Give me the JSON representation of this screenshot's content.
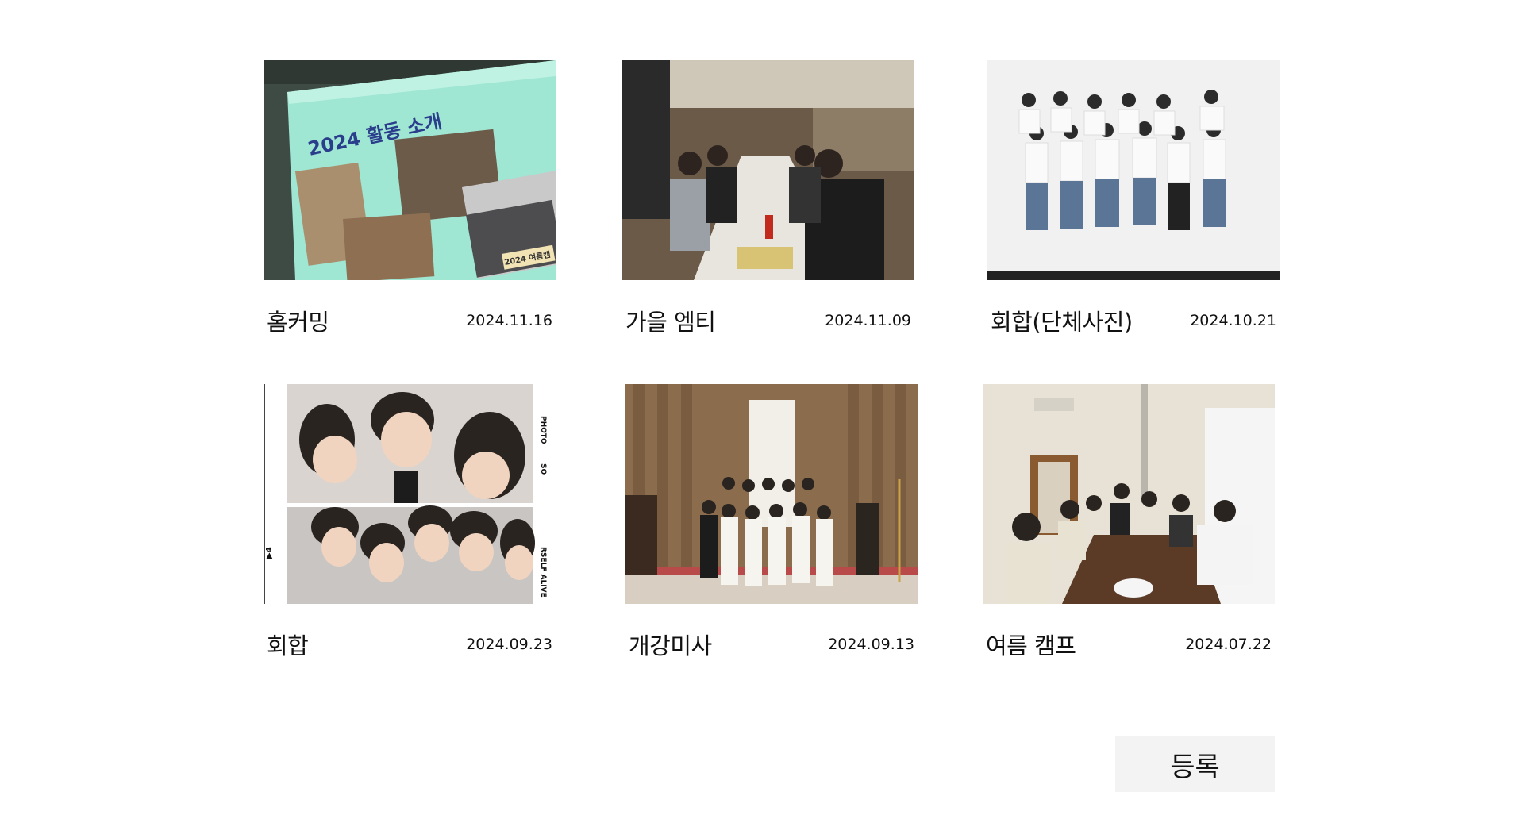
{
  "gallery": {
    "items": [
      {
        "title": "홈커밍",
        "date": "2024.11.16",
        "photo": "presentation-screen-photo"
      },
      {
        "title": "가을 엠티",
        "date": "2024.11.09",
        "photo": "group-dinner-photo"
      },
      {
        "title": "회합(단체사진)",
        "date": "2024.10.21",
        "photo": "group-studio-photo"
      },
      {
        "title": "회합",
        "date": "2024.09.23",
        "photo": "photo-booth-strip"
      },
      {
        "title": "개강미사",
        "date": "2024.09.13",
        "photo": "church-group-photo"
      },
      {
        "title": "여름 캠프",
        "date": "2024.07.22",
        "photo": "camp-dinner-photo"
      }
    ]
  },
  "photo_text": {
    "slide_heading": "2024 활동 소개",
    "slide_badge": "2024 여름캠",
    "strip_photo": "PHOTO",
    "strip_so": "SO",
    "strip_alive": "RSELF ALIVE",
    "strip_arrow": "▶4"
  },
  "actions": {
    "register_label": "등록"
  }
}
